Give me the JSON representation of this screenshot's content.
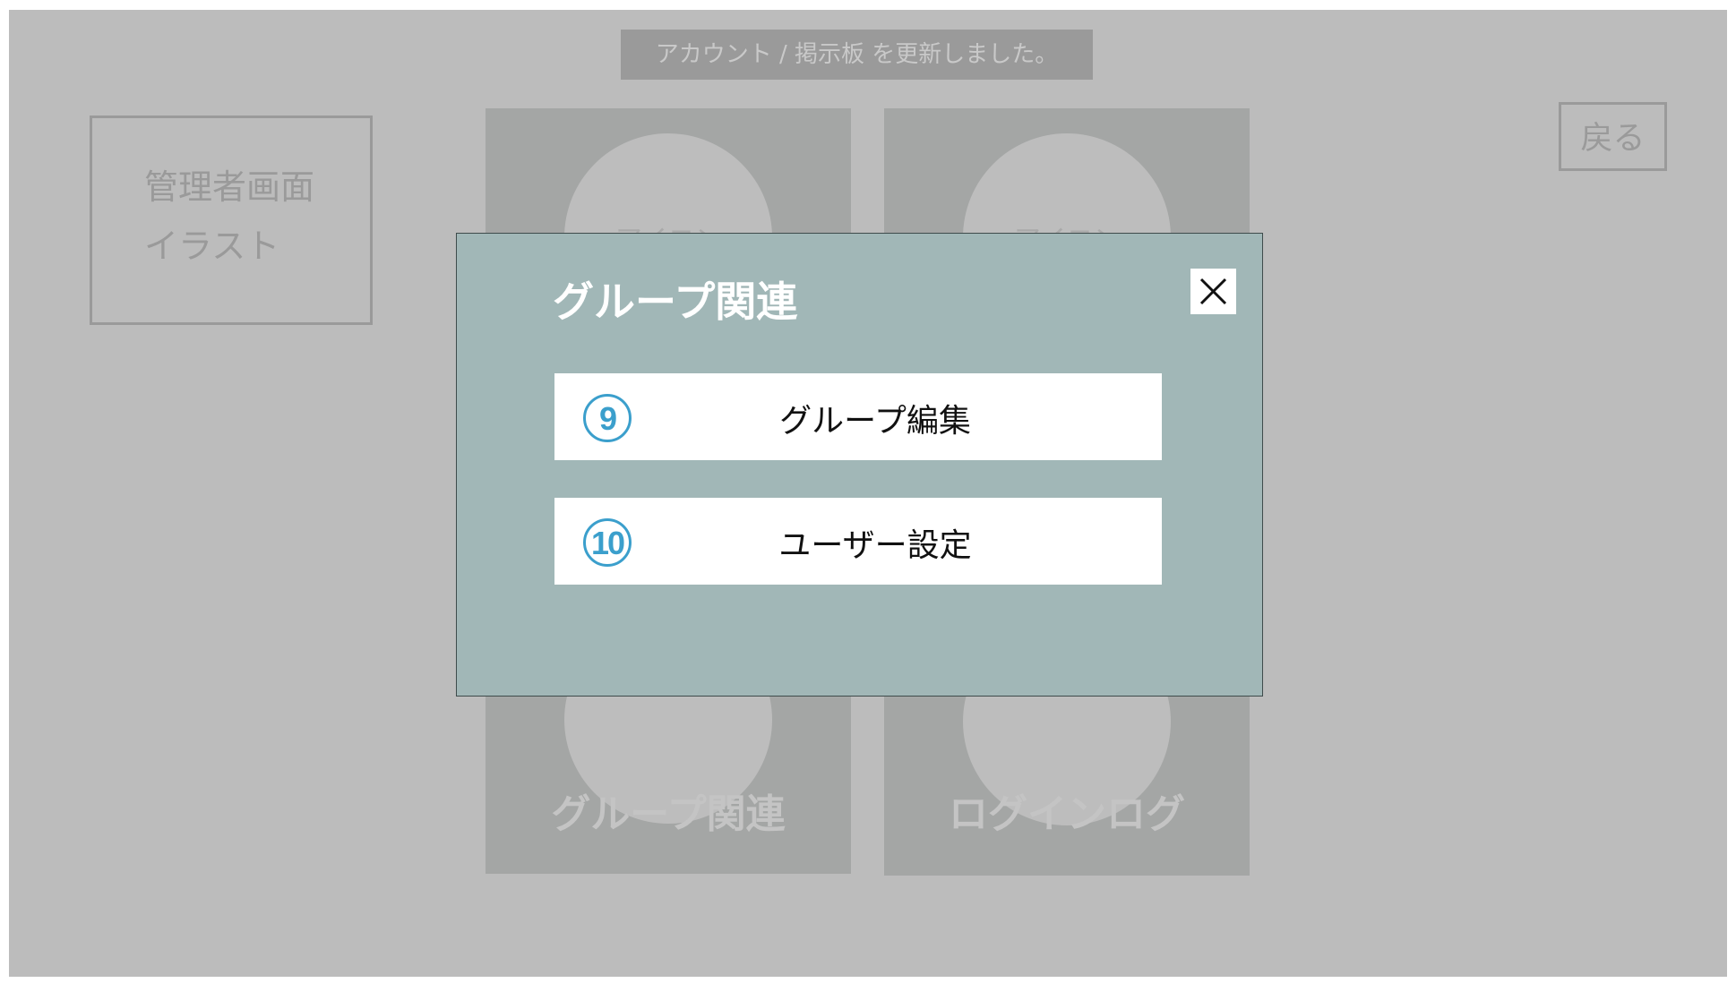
{
  "toast": {
    "message": "アカウント / 掲示板 を更新しました。"
  },
  "illustration": {
    "line1": "管理者画面",
    "line2": "イラスト"
  },
  "back_button": {
    "label": "戻る"
  },
  "cards": [
    {
      "icon_label": "アイコン",
      "label": "グループ関連"
    },
    {
      "icon_label": "アイコン",
      "label": "ログインログ"
    }
  ],
  "modal": {
    "title": "グループ関連",
    "close_icon": "close-icon",
    "items": [
      {
        "number": "9",
        "label": "グループ編集"
      },
      {
        "number": "10",
        "label": "ユーザー設定"
      }
    ]
  },
  "colors": {
    "overlay_bg": "#bcbcbc",
    "modal_bg": "#a1b7b7",
    "accent": "#3b9fcc"
  }
}
